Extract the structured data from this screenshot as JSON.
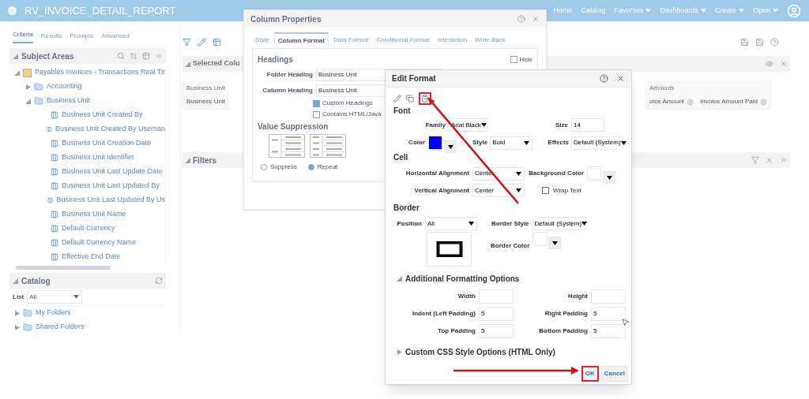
{
  "header": {
    "title": "RV_INVOICE_DETAIL_REPORT",
    "nav": [
      {
        "label": "Home",
        "dropdown": false
      },
      {
        "label": "Catalog",
        "dropdown": false
      },
      {
        "label": "Favorites",
        "dropdown": true
      },
      {
        "label": "Dashboards",
        "dropdown": true
      },
      {
        "label": "Create",
        "dropdown": true
      },
      {
        "label": "Open",
        "dropdown": true
      }
    ]
  },
  "tabs": [
    {
      "label": "Criteria",
      "selected": true
    },
    {
      "label": "Results",
      "selected": false
    },
    {
      "label": "Prompts",
      "selected": false
    },
    {
      "label": "Advanced",
      "selected": false
    }
  ],
  "subject_areas": {
    "title": "Subject Areas",
    "tree": [
      {
        "label": "Payables Invoices - Transactions Real Tir",
        "kind": "subject",
        "expanded": true,
        "children": [
          {
            "label": "Accounting",
            "kind": "folder",
            "expanded": false
          },
          {
            "label": "Business Unit",
            "kind": "folder",
            "expanded": true,
            "children": [
              {
                "label": "Business Unit Created By",
                "kind": "column"
              },
              {
                "label": "Business Unit Created By Usernan",
                "kind": "column"
              },
              {
                "label": "Business Unit Creation Date",
                "kind": "column"
              },
              {
                "label": "Business Unit Identifier",
                "kind": "column"
              },
              {
                "label": "Business Unit Last Update Date",
                "kind": "column"
              },
              {
                "label": "Business Unit Last Updated By",
                "kind": "column"
              },
              {
                "label": "Business Unit Last Updated By Us",
                "kind": "column"
              },
              {
                "label": "Business Unit Name",
                "kind": "column"
              },
              {
                "label": "Default Currency",
                "kind": "column"
              },
              {
                "label": "Default Currency Name",
                "kind": "column"
              },
              {
                "label": "Effective End Date",
                "kind": "column"
              }
            ]
          }
        ]
      }
    ]
  },
  "catalog": {
    "title": "Catalog",
    "list_label": "List",
    "list_value": "All",
    "folders": [
      {
        "label": "My Folders"
      },
      {
        "label": "Shared Folders"
      }
    ]
  },
  "selected_columns": {
    "title": "Selected Colu",
    "groups": [
      {
        "header": "Business Unit",
        "items": [
          "Business Unit"
        ]
      },
      {
        "header": "Amounts",
        "items": [
          "oice Amount",
          "Invoice Amount Paid"
        ]
      }
    ]
  },
  "filters": {
    "title": "Filters"
  },
  "column_properties": {
    "title": "Column Properties",
    "tabs": [
      {
        "label": "Style",
        "selected": false
      },
      {
        "label": "Column Format",
        "selected": true
      },
      {
        "label": "Data Format",
        "selected": false
      },
      {
        "label": "Conditional Format",
        "selected": false
      },
      {
        "label": "Interaction",
        "selected": false
      },
      {
        "label": "Write Back",
        "selected": false
      }
    ],
    "headings_title": "Headings",
    "hide": {
      "label": "Hide",
      "checked": false
    },
    "fields": [
      {
        "label": "Folder Heading",
        "value": "Business Unit"
      },
      {
        "label": "Column Heading",
        "value": "Business Unit"
      }
    ],
    "checkboxes": [
      {
        "label": "Custom Headings",
        "checked": true
      },
      {
        "label": "Contains HTML/Java",
        "checked": false
      }
    ],
    "suppression_title": "Value Suppression",
    "radios": [
      {
        "label": "Suppress",
        "selected": false
      },
      {
        "label": "Repeat",
        "selected": true
      }
    ]
  },
  "edit_format": {
    "title": "Edit Format",
    "font": {
      "title": "Font",
      "family_label": "Family",
      "family": "Arial Black",
      "size_label": "Size",
      "size": "14",
      "color_label": "Color",
      "color": "#0000ff",
      "style_label": "Style",
      "style": "Bold",
      "effects_label": "Effects",
      "effects": "Default (System)"
    },
    "cell": {
      "title": "Cell",
      "h_label": "Horizontal Alignment",
      "h_value": "Center",
      "bg_label": "Background Color",
      "v_label": "Vertical Alignment",
      "v_value": "Center",
      "wrap": {
        "label": "Wrap Text",
        "checked": false
      }
    },
    "border": {
      "title": "Border",
      "position_label": "Position",
      "position": "All",
      "style_label": "Border Style",
      "style": "Default (System)",
      "color_label": "Border Color"
    },
    "additional": {
      "title": "Additional Formatting Options",
      "expanded": true,
      "fields": [
        {
          "label": "Width"
        },
        {
          "label": "Height"
        },
        {
          "label": "Indent (Left Padding)",
          "value": "5"
        },
        {
          "label": "Right Padding",
          "value": "5"
        },
        {
          "label": "Top Padding",
          "value": "5"
        },
        {
          "label": "Bottom Padding",
          "value": "5"
        }
      ]
    },
    "custom_css": {
      "title": "Custom CSS Style Options (HTML Only)",
      "expanded": false
    },
    "buttons": [
      {
        "label": "OK",
        "highlighted": true
      },
      {
        "label": "Cancel",
        "highlighted": false
      }
    ]
  }
}
